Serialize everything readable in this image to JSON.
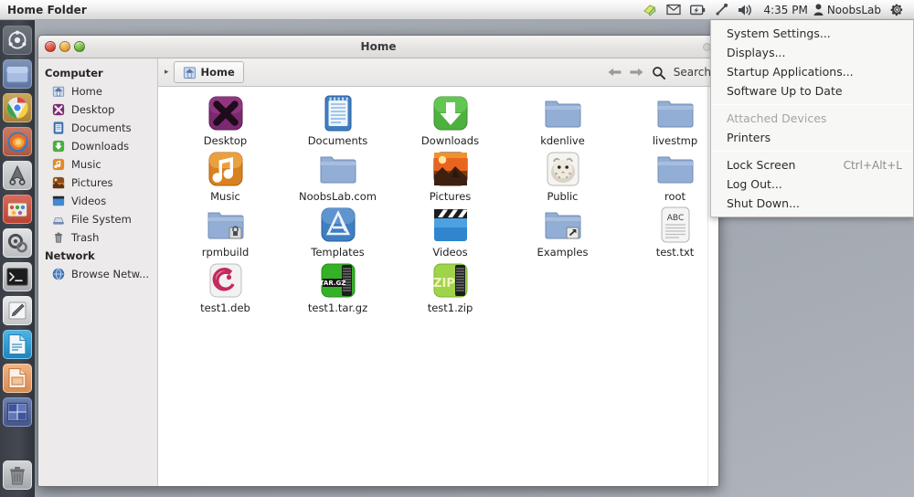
{
  "panel": {
    "title": "Home Folder",
    "clock": "4:35 PM",
    "user": "NoobsLab",
    "tray": [
      {
        "name": "sync-notify-icon",
        "label": "Sync"
      },
      {
        "name": "mail-envelope-icon",
        "label": "Messaging"
      },
      {
        "name": "battery-icon",
        "label": "Battery"
      },
      {
        "name": "bluetooth-icon",
        "label": "Bluetooth"
      },
      {
        "name": "volume-icon",
        "label": "Sound"
      }
    ],
    "gear_icon": "gear-icon",
    "user_icon": "user-icon"
  },
  "session_menu": {
    "items": [
      {
        "label": "System Settings...",
        "accel": "",
        "disabled": false,
        "separator_after": false
      },
      {
        "label": "Displays...",
        "accel": "",
        "disabled": false,
        "separator_after": false
      },
      {
        "label": "Startup Applications...",
        "accel": "",
        "disabled": false,
        "separator_after": false
      },
      {
        "label": "Software Up to Date",
        "accel": "",
        "disabled": false,
        "separator_after": true
      },
      {
        "label": "Attached Devices",
        "accel": "",
        "disabled": true,
        "separator_after": false
      },
      {
        "label": "Printers",
        "accel": "",
        "disabled": false,
        "separator_after": true
      },
      {
        "label": "Lock Screen",
        "accel": "Ctrl+Alt+L",
        "disabled": false,
        "separator_after": false
      },
      {
        "label": "Log Out...",
        "accel": "",
        "disabled": false,
        "separator_after": false
      },
      {
        "label": "Shut Down...",
        "accel": "",
        "disabled": false,
        "separator_after": false
      }
    ]
  },
  "launcher": {
    "items": [
      {
        "name": "launcher-dash-icon",
        "label": "Dash Home",
        "running": false
      },
      {
        "name": "launcher-files-icon",
        "label": "Files",
        "running": true
      },
      {
        "name": "launcher-chrome-icon",
        "label": "Google Chrome",
        "running": false
      },
      {
        "name": "launcher-firefox-icon",
        "label": "Firefox",
        "running": false
      },
      {
        "name": "launcher-inkscape-icon",
        "label": "Inkscape",
        "running": false
      },
      {
        "name": "launcher-ubuntu-software-icon",
        "label": "Ubuntu Software Center",
        "running": false
      },
      {
        "name": "launcher-system-settings-icon",
        "label": "System Settings",
        "running": false
      },
      {
        "name": "launcher-terminal-icon",
        "label": "Terminal",
        "running": false
      },
      {
        "name": "launcher-text-editor-icon",
        "label": "Text Editor",
        "running": false
      },
      {
        "name": "launcher-writer-icon",
        "label": "LibreOffice Writer",
        "running": false
      },
      {
        "name": "launcher-impress-icon",
        "label": "LibreOffice Impress",
        "running": false
      },
      {
        "name": "launcher-workspace-icon",
        "label": "Workspace Switcher",
        "running": false
      }
    ],
    "trash": {
      "name": "launcher-trash-icon",
      "label": "Trash"
    }
  },
  "window": {
    "title": "Home",
    "controls": {
      "close": "Close",
      "minimize": "Minimize",
      "maximize": "Maximize"
    },
    "toolbar": {
      "breadcrumb": "Home",
      "breadcrumb_icon": "home-folder-icon",
      "back_icon": "arrow-left-icon",
      "forward_icon": "arrow-right-icon",
      "search_icon": "search-icon",
      "search_label": "Search"
    },
    "sidebar": {
      "groups": [
        {
          "title": "Computer",
          "items": [
            {
              "label": "Home",
              "icon": "home-icon"
            },
            {
              "label": "Desktop",
              "icon": "desktop-xfce-icon"
            },
            {
              "label": "Documents",
              "icon": "documents-icon"
            },
            {
              "label": "Downloads",
              "icon": "downloads-icon"
            },
            {
              "label": "Music",
              "icon": "music-icon"
            },
            {
              "label": "Pictures",
              "icon": "pictures-icon"
            },
            {
              "label": "Videos",
              "icon": "videos-icon"
            },
            {
              "label": "File System",
              "icon": "drive-icon"
            },
            {
              "label": "Trash",
              "icon": "trash-icon"
            }
          ]
        },
        {
          "title": "Network",
          "items": [
            {
              "label": "Browse Netw...",
              "icon": "network-icon"
            }
          ]
        }
      ]
    },
    "files": [
      {
        "label": "Desktop",
        "icon": "xfce-desktop-icon"
      },
      {
        "label": "Documents",
        "icon": "documents-folder-icon"
      },
      {
        "label": "Downloads",
        "icon": "downloads-folder-icon"
      },
      {
        "label": "kdenlive",
        "icon": "folder-icon"
      },
      {
        "label": "livestmp",
        "icon": "folder-icon"
      },
      {
        "label": "Music",
        "icon": "music-folder-icon"
      },
      {
        "label": "NoobsLab.com",
        "icon": "folder-icon"
      },
      {
        "label": "Pictures",
        "icon": "pictures-folder-icon"
      },
      {
        "label": "Public",
        "icon": "public-leopard-icon"
      },
      {
        "label": "root",
        "icon": "folder-icon"
      },
      {
        "label": "rpmbuild",
        "icon": "folder-locked-icon"
      },
      {
        "label": "Templates",
        "icon": "templates-folder-icon"
      },
      {
        "label": "Videos",
        "icon": "videos-folder-icon"
      },
      {
        "label": "Examples",
        "icon": "folder-link-icon"
      },
      {
        "label": "test.txt",
        "icon": "text-file-icon"
      },
      {
        "label": "test1.deb",
        "icon": "deb-package-icon"
      },
      {
        "label": "test1.tar.gz",
        "icon": "targz-archive-icon"
      },
      {
        "label": "test1.zip",
        "icon": "zip-archive-icon"
      }
    ]
  },
  "colors": {
    "panel_bg": "#f0efee",
    "launcher_bg": "#3b4048",
    "desktop_bg": "#a9aeb6",
    "folder_blue": "#8ba4cc",
    "accent_orange": "#dd6a21"
  }
}
